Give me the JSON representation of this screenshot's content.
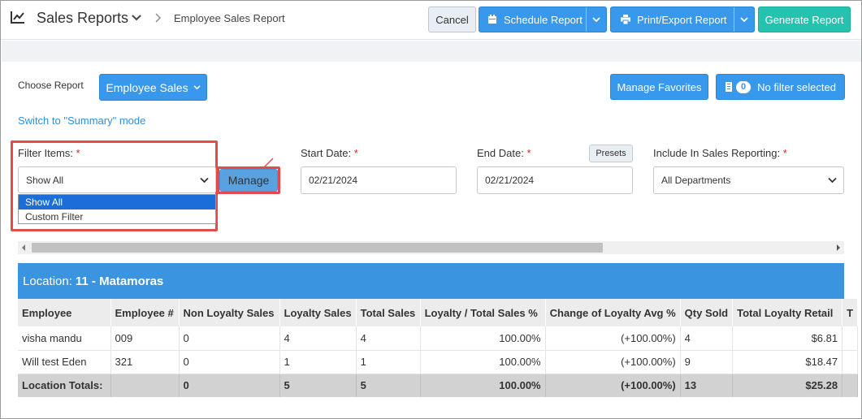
{
  "header": {
    "title": "Sales Reports",
    "breadcrumb": "Employee Sales Report",
    "cancel_label": "Cancel",
    "schedule_label": "Schedule Report",
    "print_label": "Print/Export Report",
    "generate_label": "Generate Report"
  },
  "report_select": {
    "label": "Choose Report",
    "value": "Employee Sales",
    "manage_favorites_label": "Manage Favorites",
    "filter_count": "0",
    "filter_status": "No filter selected",
    "switch_mode_link": "Switch to \"Summary\" mode"
  },
  "filters": {
    "filter_items_label": "Filter Items:",
    "required_mark": "*",
    "filter_items_value": "Show All",
    "filter_items_options": [
      "Show All",
      "Custom Filter"
    ],
    "manage_label": "Manage",
    "start_date_label": "Start Date:",
    "start_date_value": "02/21/2024",
    "end_date_label": "End Date:",
    "end_date_value": "02/21/2024",
    "presets_label": "Presets",
    "include_label": "Include In Sales Reporting:",
    "include_value": "All Departments"
  },
  "location": {
    "label": "Location:",
    "name": "11 - Matamoras"
  },
  "table": {
    "columns": [
      "Employee",
      "Employee #",
      "Non Loyalty Sales",
      "Loyalty Sales",
      "Total Sales",
      "Loyalty / Total Sales %",
      "Change of Loyalty Avg %",
      "Qty Sold",
      "Total Loyalty Retail",
      "T"
    ],
    "rows": [
      [
        "visha mandu",
        "009",
        "0",
        "4",
        "4",
        "100.00%",
        "(+100.00%)",
        "4",
        "$6.81"
      ],
      [
        "Will test Eden",
        "321",
        "0",
        "1",
        "1",
        "100.00%",
        "(+100.00%)",
        "9",
        "$18.47"
      ]
    ],
    "totals": [
      "Location Totals:",
      "",
      "0",
      "5",
      "5",
      "100.00%",
      "(+100.00%)",
      "13",
      "$25.28"
    ]
  },
  "colors": {
    "primary": "#3898ec",
    "generate": "#23c3b0",
    "location_bar": "#3a94e0",
    "highlight_box": "#e04b4b",
    "positive": "#1a8a2a"
  },
  "icons": {
    "header": "line-chart-icon",
    "schedule": "calendar-icon",
    "print": "printer-icon",
    "filter": "filter-icon"
  }
}
